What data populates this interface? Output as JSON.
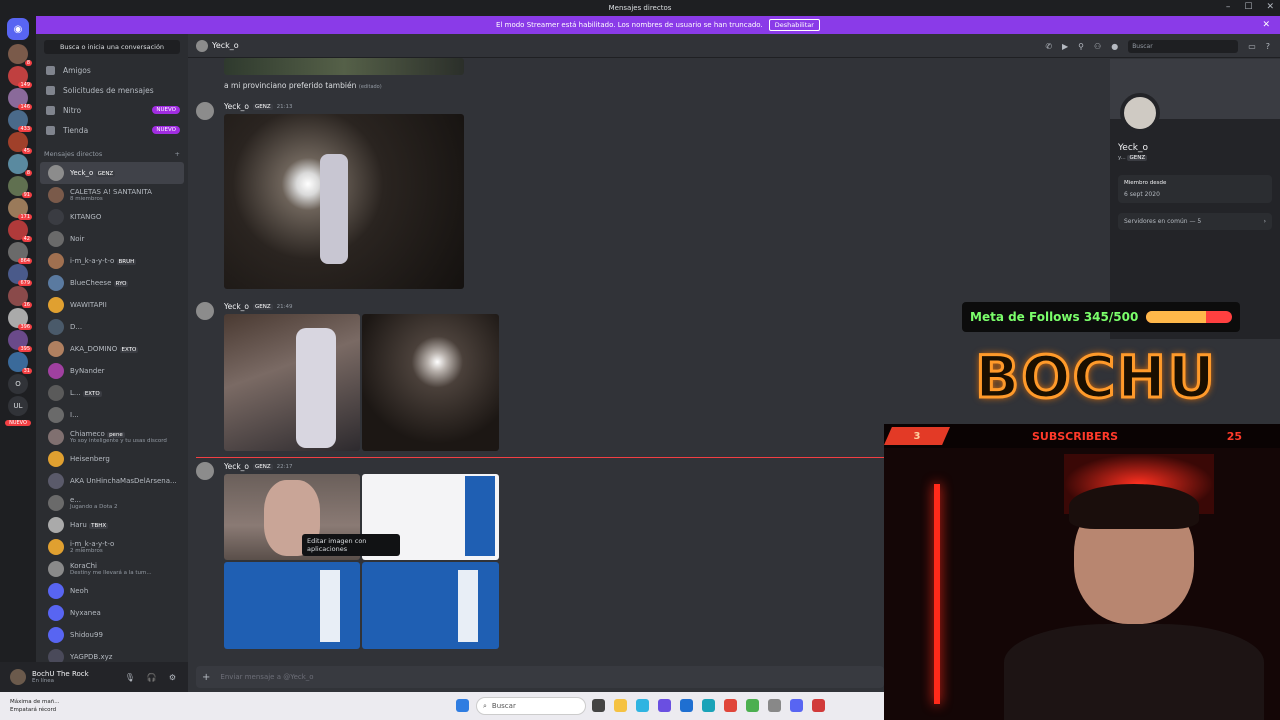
{
  "window": {
    "title": "Mensajes directos"
  },
  "banner": {
    "text": "El modo Streamer está habilitado. Los nombres de usuario se han truncado.",
    "button": "Deshabilitar"
  },
  "guild_badges": [
    "8",
    "149",
    "146",
    "433",
    "45",
    "8",
    "91",
    "171",
    "42",
    "864",
    "679",
    "16",
    "396",
    "395",
    "31"
  ],
  "guild_letters": [
    "O",
    "UL"
  ],
  "guild_new": "NUEVO",
  "dm_sidebar": {
    "search_placeholder": "Busca o inicia una conversación",
    "nav": [
      {
        "label": "Amigos"
      },
      {
        "label": "Solicitudes de mensajes"
      },
      {
        "label": "Nitro",
        "pill": "NUEVO"
      },
      {
        "label": "Tienda",
        "pill": "NUEVO"
      }
    ],
    "section_label": "Mensajes directos",
    "add": "+",
    "dms": [
      {
        "name": "Yeck_o",
        "tag": "GENZ",
        "sub": ""
      },
      {
        "name": "CALETAS A! SANTANITA",
        "tag": "",
        "sub": "8 miembros"
      },
      {
        "name": "KITANGO",
        "tag": "",
        "sub": ""
      },
      {
        "name": "Noir",
        "tag": "",
        "sub": ""
      },
      {
        "name": "i-m_k-a-y-t-o",
        "tag": "BRUH",
        "sub": ""
      },
      {
        "name": "BlueCheese",
        "tag": "RYO",
        "sub": ""
      },
      {
        "name": "WAWITAPII",
        "tag": "",
        "sub": ""
      },
      {
        "name": "D...",
        "tag": "",
        "sub": ""
      },
      {
        "name": "AKA_DOMINO",
        "tag": "EXTO",
        "sub": ""
      },
      {
        "name": "ByNander",
        "tag": "",
        "sub": ""
      },
      {
        "name": "L...",
        "tag": "EXTO",
        "sub": ""
      },
      {
        "name": "I...",
        "tag": "",
        "sub": ""
      },
      {
        "name": "Chiameco",
        "tag": "pene",
        "sub": "Yo soy inteligente y tu usas discord"
      },
      {
        "name": "Heisenberg",
        "tag": "",
        "sub": ""
      },
      {
        "name": "AKA UnHinchaMasDelArsena...",
        "tag": "",
        "sub": ""
      },
      {
        "name": "e...",
        "tag": "",
        "sub": "Jugando a Dota 2"
      },
      {
        "name": "Haru",
        "tag": "TBHX",
        "sub": ""
      },
      {
        "name": "i-m_k-a-y-t-o",
        "tag": "",
        "sub": "2 miembros"
      },
      {
        "name": "KoraChi",
        "tag": "",
        "sub": "Destiny me llevará a la tum..."
      },
      {
        "name": "Neoh",
        "tag": "",
        "sub": ""
      },
      {
        "name": "Nyxanea",
        "tag": "",
        "sub": ""
      },
      {
        "name": "Shidou99",
        "tag": "",
        "sub": ""
      },
      {
        "name": "YAGPDB.xyz",
        "tag": "",
        "sub": ""
      }
    ]
  },
  "user": {
    "name": "BochU The Rock",
    "status": "En línea"
  },
  "chat": {
    "header_name": "Yeck_o",
    "search_placeholder": "Buscar",
    "prev_text": "a mi provinciano preferido también",
    "prev_edited": "(editado)",
    "messages": [
      {
        "author": "Yeck_o",
        "tag": "GENZ",
        "time": "21:13"
      },
      {
        "author": "Yeck_o",
        "tag": "GENZ",
        "time": "21:49"
      },
      {
        "author": "Yeck_o",
        "tag": "GENZ",
        "time": "22:17"
      }
    ],
    "tooltip": "Editar imagen con aplicaciones",
    "composer_placeholder": "Enviar mensaje a @Yeck_o"
  },
  "profile": {
    "name": "Yeck_o",
    "sub": "y...",
    "tag": "GENZ",
    "member_since_label": "Miembro desde",
    "member_since": "6 sept 2020",
    "common_servers": "Servidores en común — 5"
  },
  "overlay": {
    "goal_text": "Meta de Follows 345/500",
    "goal_progress": 0.69,
    "logo": "BOCHU",
    "subs_number": "3",
    "subs_label": "SUBSCRIBERS",
    "subs_count": "25"
  },
  "taskbar": {
    "weather_line1": "Máxima de mañ...",
    "weather_line2": "Empatará récord",
    "search": "Buscar"
  },
  "colors": {
    "accent": "#5865f2",
    "banner": "#8a3be8",
    "nitro_pill": "#a12de1",
    "goal_green": "#7bff6b"
  }
}
